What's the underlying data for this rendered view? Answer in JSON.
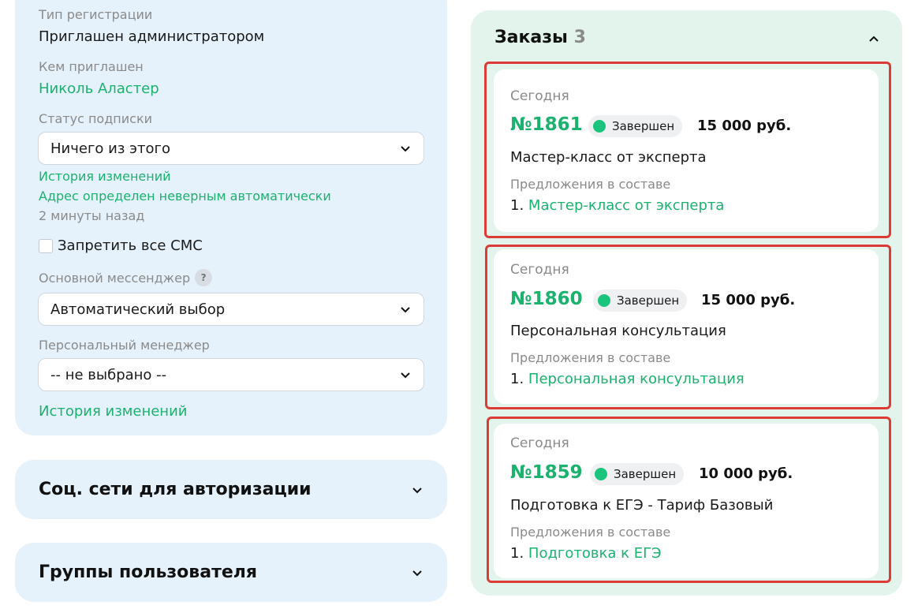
{
  "profile": {
    "reg_type_label": "Тип регистрации",
    "reg_type_value": "Приглашен администратором",
    "invited_by_label": "Кем приглашен",
    "invited_by_value": "Николь Аластер",
    "subscription_label": "Статус подписки",
    "subscription_value": "Ничего из этого",
    "history_link": "История изменений",
    "address_note": "Адрес определен неверным автоматически",
    "address_time": "2 минуты назад",
    "sms_label": "Запретить все СМС",
    "messenger_label": "Основной мессенджер",
    "messenger_help": "?",
    "messenger_value": "Автоматический выбор",
    "manager_label": "Персональный менеджер",
    "manager_value": "-- не выбрано --",
    "history_link_2": "История изменений"
  },
  "accordions": {
    "social": "Соц. сети для авторизации",
    "groups": "Группы пользователя"
  },
  "orders": {
    "title": "Заказы",
    "count": "3",
    "items": [
      {
        "date": "Сегодня",
        "number": "№1861",
        "status": "Завершен",
        "price": "15 000 руб.",
        "title": "Мастер-класс от эксперта",
        "offers_label": "Предложения в составе",
        "offer_index": "1.",
        "offer_name": "Мастер-класс от эксперта"
      },
      {
        "date": "Сегодня",
        "number": "№1860",
        "status": "Завершен",
        "price": "15 000 руб.",
        "title": "Персональная консультация",
        "offers_label": "Предложения в составе",
        "offer_index": "1.",
        "offer_name": "Персональная консультация"
      },
      {
        "date": "Сегодня",
        "number": "№1859",
        "status": "Завершен",
        "price": "10 000 руб.",
        "title": "Подготовка к ЕГЭ - Тариф Базовый",
        "offers_label": "Предложения в составе",
        "offer_index": "1.",
        "offer_name": "Подготовка к ЕГЭ"
      }
    ]
  },
  "colors": {
    "accent": "#1bb26e",
    "highlight": "#dc3c36",
    "panel_blue": "#e6f2fb",
    "panel_green": "#e3f4ec"
  },
  "icons": {
    "dropdown": "chevron-down-icon",
    "collapse": "chevron-up-icon",
    "status": "status-dot-icon"
  }
}
